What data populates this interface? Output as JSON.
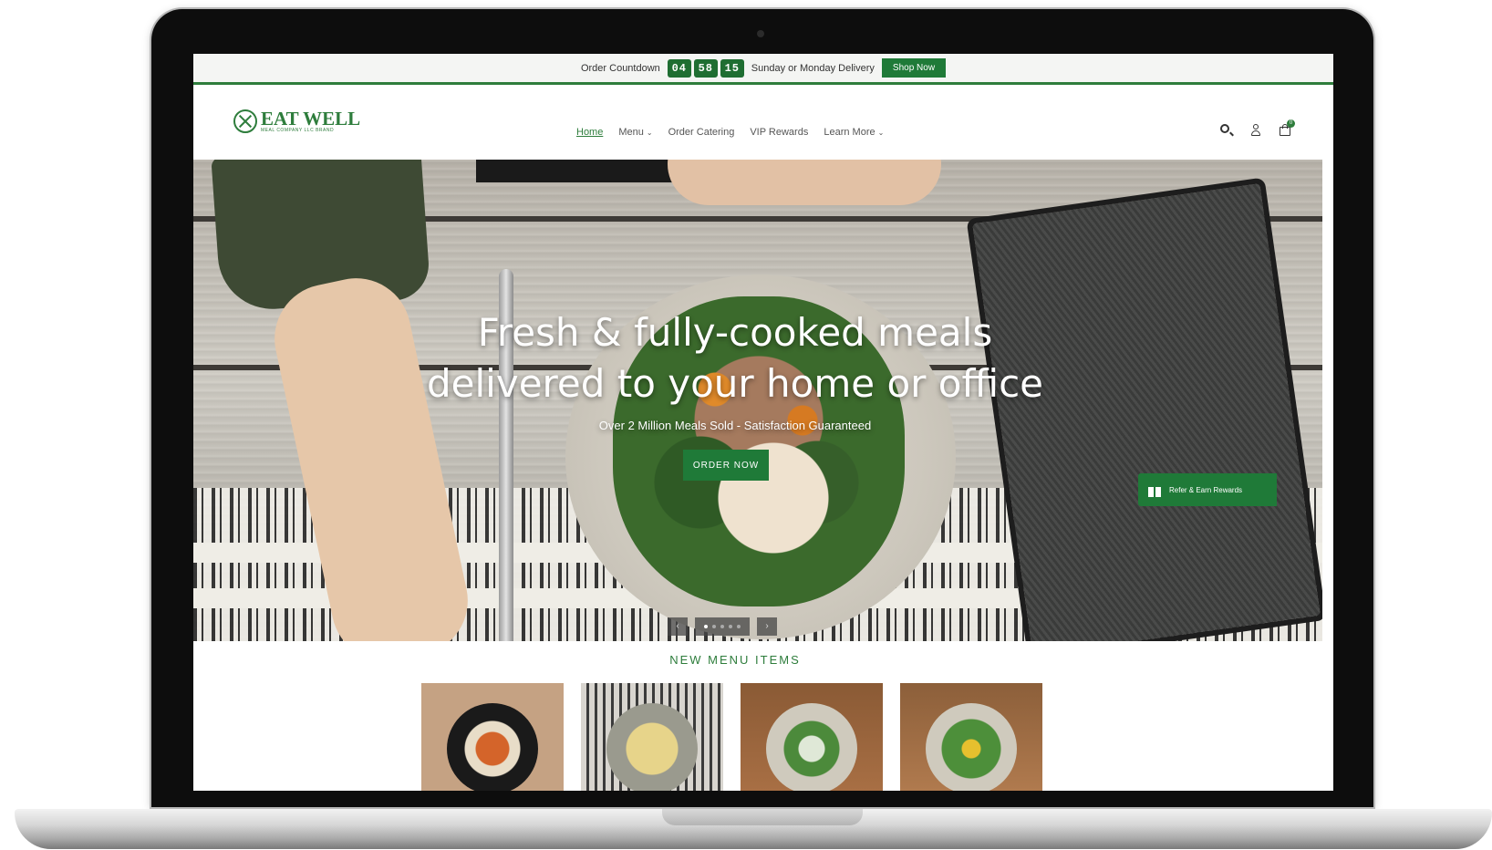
{
  "announcement": {
    "label": "Order Countdown",
    "countdown": [
      "04",
      "58",
      "15"
    ],
    "delivery_text": "Sunday or Monday Delivery",
    "cta": "Shop Now"
  },
  "brand": {
    "name": "EAT WELL",
    "tagline": "MEAL COMPANY LLC BRAND",
    "accent_color": "#2e7d3c"
  },
  "nav": {
    "items": [
      {
        "label": "Home",
        "active": true,
        "has_dropdown": false
      },
      {
        "label": "Menu",
        "active": false,
        "has_dropdown": true
      },
      {
        "label": "Order Catering",
        "active": false,
        "has_dropdown": false
      },
      {
        "label": "VIP Rewards",
        "active": false,
        "has_dropdown": false
      },
      {
        "label": "Learn More",
        "active": false,
        "has_dropdown": true
      }
    ],
    "icons": [
      "search-icon",
      "account-icon",
      "cart-icon"
    ],
    "cart_count": "0"
  },
  "hero": {
    "title_line1": "Fresh & fully-cooked meals",
    "title_line2": "delivered to your home or office",
    "subtitle": "Over 2 Million Meals Sold - Satisfaction Guaranteed",
    "cta": "ORDER NOW",
    "slide_count": 5,
    "active_slide": 1,
    "prev": "‹",
    "next": "›"
  },
  "refer": {
    "label": "Refer & Earn Rewards"
  },
  "menu_section": {
    "title": "NEW MENU ITEMS"
  }
}
